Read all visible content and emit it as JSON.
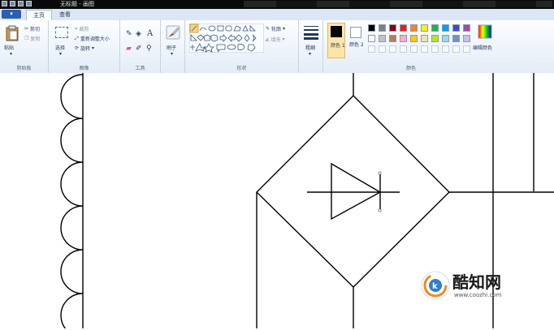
{
  "window": {
    "title": "无标题 - 画图"
  },
  "tabs": [
    {
      "label": "主页"
    },
    {
      "label": "查看"
    }
  ],
  "clipboard": {
    "paste": "粘贴",
    "cut": "剪切",
    "copy": "复制",
    "group": "剪贴板"
  },
  "image": {
    "select": "选择",
    "crop": "裁剪",
    "resize": "重新调整大小",
    "rotate": "旋转",
    "group": "图像"
  },
  "tools": {
    "group": "工具"
  },
  "brushes": {
    "label": "刷子"
  },
  "shapes": {
    "outline": "轮廓",
    "fill": "填充",
    "group": "形状"
  },
  "size": {
    "label": "粗细"
  },
  "colors": {
    "color1": "颜色 1",
    "color2": "颜色 2",
    "edit": "编辑颜色",
    "group": "颜色",
    "palette_row1": [
      "#000000",
      "#7f7f7f",
      "#880015",
      "#ed1c24",
      "#ff7f27",
      "#fff200",
      "#22b14c",
      "#00a2e8",
      "#3f48cc",
      "#a349a4"
    ],
    "palette_row2": [
      "#ffffff",
      "#c3c3c3",
      "#b97a57",
      "#ffaec9",
      "#ffc90e",
      "#efe4b0",
      "#b5e61d",
      "#99d9ea",
      "#7092be",
      "#c8bfe7"
    ]
  },
  "watermark": {
    "title": "酷知网",
    "url": "www.coozhi.com"
  }
}
